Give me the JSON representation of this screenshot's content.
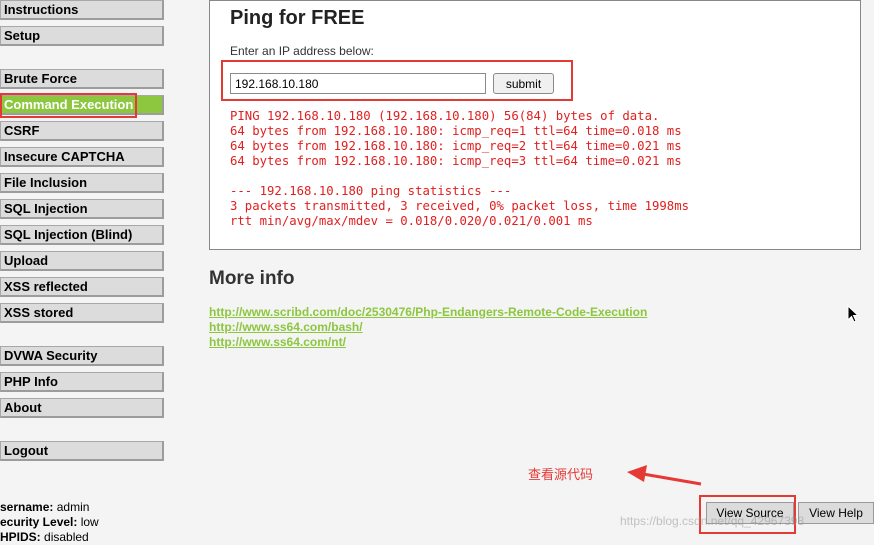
{
  "sidebar": {
    "items": [
      {
        "label": "Instructions"
      },
      {
        "label": "Setup"
      },
      {
        "label": "Brute Force"
      },
      {
        "label": "Command Execution"
      },
      {
        "label": "CSRF"
      },
      {
        "label": "Insecure CAPTCHA"
      },
      {
        "label": "File Inclusion"
      },
      {
        "label": "SQL Injection"
      },
      {
        "label": "SQL Injection (Blind)"
      },
      {
        "label": "Upload"
      },
      {
        "label": "XSS reflected"
      },
      {
        "label": "XSS stored"
      },
      {
        "label": "DVWA Security"
      },
      {
        "label": "PHP Info"
      },
      {
        "label": "About"
      },
      {
        "label": "Logout"
      }
    ],
    "active": "Command Execution"
  },
  "status": {
    "username_label": "sername:",
    "username_value": "admin",
    "security_label": "ecurity Level:",
    "security_value": "low",
    "phpids_label": "HPIDS:",
    "phpids_value": "disabled"
  },
  "ping": {
    "title": "Ping for FREE",
    "label": "Enter an IP address below:",
    "input_value": "192.168.10.180",
    "submit_label": "submit",
    "output": [
      "PING 192.168.10.180 (192.168.10.180) 56(84) bytes of data.",
      "64 bytes from 192.168.10.180: icmp_req=1 ttl=64 time=0.018 ms",
      "64 bytes from 192.168.10.180: icmp_req=2 ttl=64 time=0.021 ms",
      "64 bytes from 192.168.10.180: icmp_req=3 ttl=64 time=0.021 ms",
      "",
      "--- 192.168.10.180 ping statistics ---",
      "3 packets transmitted, 3 received, 0% packet loss, time 1998ms",
      "rtt min/avg/max/mdev = 0.018/0.020/0.021/0.001 ms"
    ]
  },
  "more_info": {
    "title": "More info",
    "links": [
      "http://www.scribd.com/doc/2530476/Php-Endangers-Remote-Code-Execution",
      "http://www.ss64.com/bash/",
      "http://www.ss64.com/nt/"
    ]
  },
  "annotation": {
    "text": "查看源代码"
  },
  "buttons": {
    "view_source": "View Source",
    "view_help": "View Help"
  },
  "watermark": "https://blog.csdn.net/qq_42967398",
  "icons": {
    "arrow": "arrow-left-icon",
    "cursor": "mouse-cursor-icon"
  },
  "colors": {
    "accent_green": "#8dc63f",
    "output_red": "#e02020",
    "highlight_red": "#e53935"
  }
}
